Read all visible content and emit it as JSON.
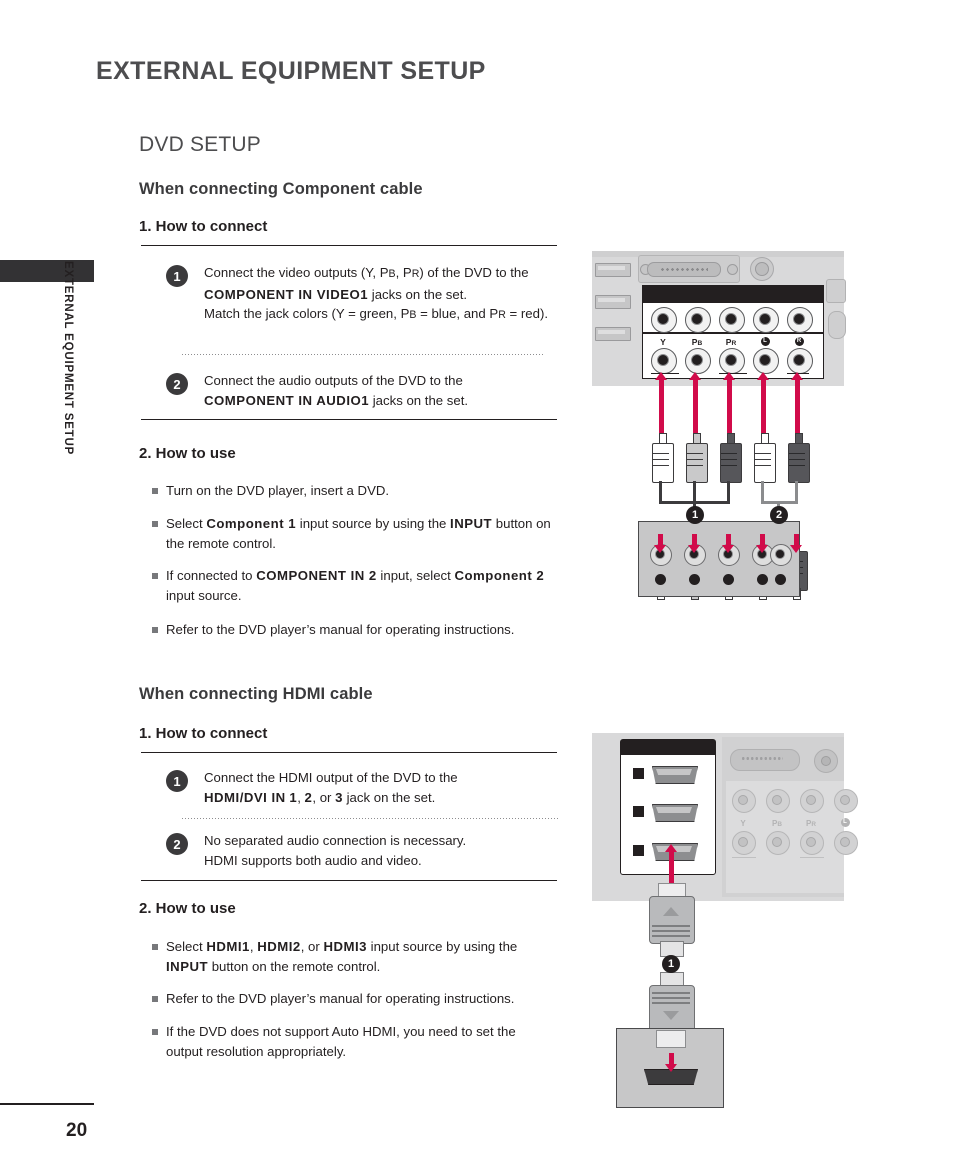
{
  "page": {
    "chapter_title": "EXTERNAL EQUIPMENT SETUP",
    "sidebar_label": "EXTERNAL EQUIPMENT SETUP",
    "page_number": "20",
    "section_title": "DVD SETUP",
    "accent_color": "#d10b4a",
    "header_color": "#4d4d4f"
  },
  "component": {
    "sub_title": "When connecting Component cable",
    "how_to_connect_title": "1. How to connect",
    "how_to_use_title": "2. How to use",
    "steps": [
      {
        "number": "1",
        "line1_pre": "Connect the video outputs (Y, P",
        "line1_sub1": "B",
        "line1_mid": ", P",
        "line1_sub2": "R",
        "line1_post": ")  of the DVD to the",
        "line2_bold": "COMPONENT IN VIDEO1",
        "line2_post": " jacks on the set.",
        "line3_pre": "Match the jack colors (Y = green, P",
        "line3_sub1": "B",
        "line3_mid": " = blue, and P",
        "line3_sub2": "R",
        "line3_post": " = red)."
      },
      {
        "number": "2",
        "line1": "Connect the audio outputs of the DVD to the",
        "line2_bold": "COMPONENT IN AUDIO1",
        "line2_post": " jacks on the set."
      }
    ],
    "bullets": [
      {
        "text": "Turn on the DVD player, insert a DVD."
      },
      {
        "pre": "Select ",
        "bold1": "Component 1",
        "mid": " input source by using the ",
        "bold2": "INPUT",
        "post": " button on the remote control."
      },
      {
        "pre": "If connected to ",
        "bold1": "COMPONENT IN 2",
        "mid": " input, select ",
        "bold2": "Component 2",
        "post": " input source."
      },
      {
        "text": "Refer to the DVD player’s manual for operating instructions."
      }
    ],
    "diagram": {
      "jack_labels": [
        "Y",
        "PB",
        "PR",
        "L",
        "R"
      ],
      "jack_label_subs": [
        "",
        "B",
        "R",
        "",
        ""
      ],
      "cable_markers": [
        "1",
        "2"
      ],
      "plug_colors": [
        "white",
        "grey",
        "dark",
        "white",
        "dark"
      ]
    }
  },
  "hdmi": {
    "sub_title": "When connecting HDMI cable",
    "how_to_connect_title": "1. How to connect",
    "how_to_use_title": "2. How to use",
    "steps": [
      {
        "number": "1",
        "line1": "Connect the HDMI output of the DVD to the",
        "line2_bold": "HDMI/DVI IN",
        "line2_n1": "1",
        "line2_sep1": ", ",
        "line2_n2": "2",
        "line2_sep2": ", or ",
        "line2_n3": "3",
        "line2_post": " jack on the set."
      },
      {
        "number": "2",
        "line1": "No separated audio connection is necessary.",
        "line2": "HDMI supports both audio and video."
      }
    ],
    "bullets": [
      {
        "pre": "Select ",
        "bold1": "HDMI1",
        "sep1": ", ",
        "bold2": "HDMI2",
        "sep2": ", or ",
        "bold3": "HDMI3",
        "mid": " input source by using the ",
        "bold4": "INPUT",
        "post": " button on the remote control."
      },
      {
        "text": "Refer to the DVD player’s manual for operating instructions."
      },
      {
        "text": "If the DVD does not support Auto HDMI, you need to set the output resolution appropriately."
      }
    ],
    "diagram": {
      "port_count": "3",
      "cable_marker": "1",
      "ghost_labels": [
        "Y",
        "PB",
        "PR",
        "L"
      ]
    }
  }
}
